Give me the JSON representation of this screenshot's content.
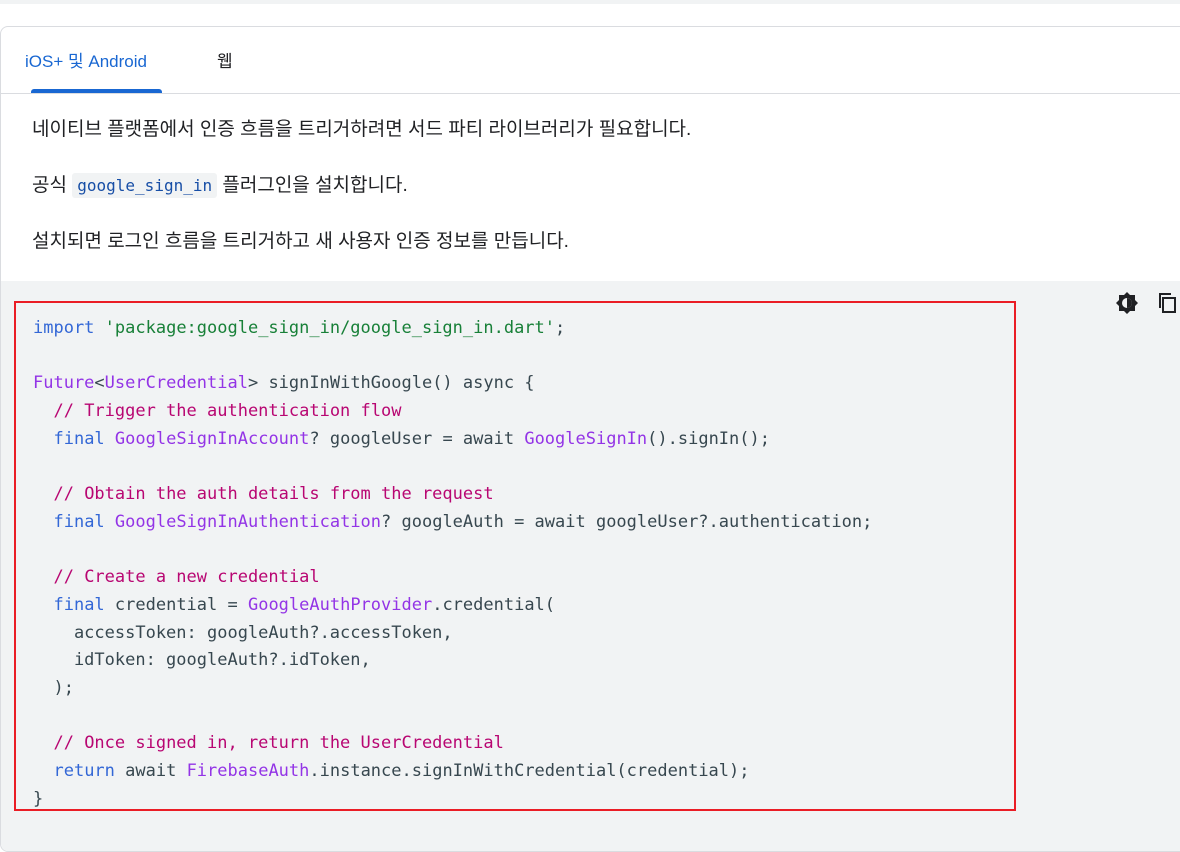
{
  "tabs": [
    {
      "label": "iOS+ 및 Android",
      "active": true
    },
    {
      "label": "웹",
      "active": false
    }
  ],
  "paragraphs": {
    "p1": "네이티브 플랫폼에서 인증 흐름을 트리거하려면 서드 파티 라이브러리가 필요합니다.",
    "p2_prefix": "공식 ",
    "p2_code": "google_sign_in",
    "p2_suffix": " 플러그인을 설치합니다.",
    "p3": "설치되면 로그인 흐름을 트리거하고 새 사용자 인증 정보를 만듭니다."
  },
  "code_actions": {
    "theme_icon": "dark-theme-toggle-icon",
    "copy_icon": "copy-icon"
  },
  "colors": {
    "accent": "#1967d2",
    "highlight_border": "#ea1d25",
    "code_bg": "#f1f3f4",
    "keyword": "#3367d6",
    "string": "#188038",
    "type": "#9334e6",
    "comment": "#b80672"
  },
  "code_lines": [
    [
      {
        "t": "import",
        "c": "kw"
      },
      {
        "t": " ",
        "c": "pun"
      },
      {
        "t": "'package:google_sign_in/google_sign_in.dart'",
        "c": "str"
      },
      {
        "t": ";",
        "c": "pun"
      }
    ],
    [],
    [
      {
        "t": "Future",
        "c": "typ"
      },
      {
        "t": "<",
        "c": "pun"
      },
      {
        "t": "UserCredential",
        "c": "typ"
      },
      {
        "t": "> signInWithGoogle() async {",
        "c": "pun"
      }
    ],
    [
      {
        "t": "  ",
        "c": "pun"
      },
      {
        "t": "// Trigger the authentication flow",
        "c": "cmt"
      }
    ],
    [
      {
        "t": "  ",
        "c": "pun"
      },
      {
        "t": "final",
        "c": "kw"
      },
      {
        "t": " ",
        "c": "pun"
      },
      {
        "t": "GoogleSignInAccount",
        "c": "typ"
      },
      {
        "t": "? googleUser = await ",
        "c": "pun"
      },
      {
        "t": "GoogleSignIn",
        "c": "typ"
      },
      {
        "t": "().signIn();",
        "c": "pun"
      }
    ],
    [],
    [
      {
        "t": "  ",
        "c": "pun"
      },
      {
        "t": "// Obtain the auth details from the request",
        "c": "cmt"
      }
    ],
    [
      {
        "t": "  ",
        "c": "pun"
      },
      {
        "t": "final",
        "c": "kw"
      },
      {
        "t": " ",
        "c": "pun"
      },
      {
        "t": "GoogleSignInAuthentication",
        "c": "typ"
      },
      {
        "t": "? googleAuth = await googleUser?.authentication;",
        "c": "pun"
      }
    ],
    [],
    [
      {
        "t": "  ",
        "c": "pun"
      },
      {
        "t": "// Create a new credential",
        "c": "cmt"
      }
    ],
    [
      {
        "t": "  ",
        "c": "pun"
      },
      {
        "t": "final",
        "c": "kw"
      },
      {
        "t": " credential = ",
        "c": "pun"
      },
      {
        "t": "GoogleAuthProvider",
        "c": "typ"
      },
      {
        "t": ".credential(",
        "c": "pun"
      }
    ],
    [
      {
        "t": "    accessToken: googleAuth?.accessToken,",
        "c": "pun"
      }
    ],
    [
      {
        "t": "    idToken: googleAuth?.idToken,",
        "c": "pun"
      }
    ],
    [
      {
        "t": "  );",
        "c": "pun"
      }
    ],
    [],
    [
      {
        "t": "  ",
        "c": "pun"
      },
      {
        "t": "// Once signed in, return the UserCredential",
        "c": "cmt"
      }
    ],
    [
      {
        "t": "  ",
        "c": "pun"
      },
      {
        "t": "return",
        "c": "kw"
      },
      {
        "t": " await ",
        "c": "pun"
      },
      {
        "t": "FirebaseAuth",
        "c": "typ"
      },
      {
        "t": ".instance.signInWithCredential(credential);",
        "c": "pun"
      }
    ],
    [
      {
        "t": "}",
        "c": "pun"
      }
    ]
  ]
}
